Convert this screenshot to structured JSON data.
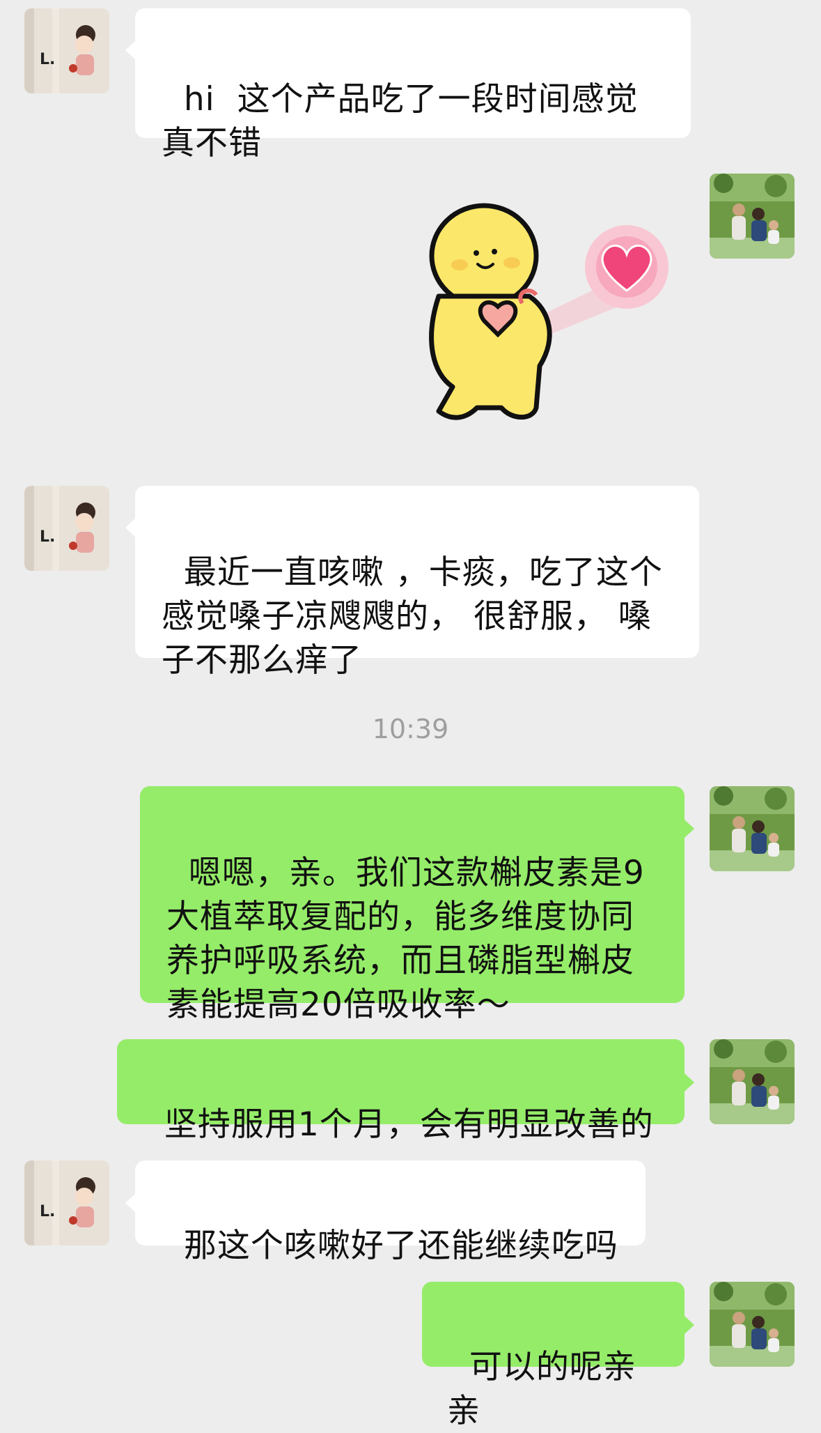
{
  "messages": [
    {
      "from": "contact",
      "text": "hi  这个产品吃了一段时间感觉真不错"
    },
    {
      "from": "me",
      "type": "sticker",
      "sticker": "yellow-blob-heart-gesture-sticker"
    },
    {
      "from": "contact",
      "text": "最近一直咳嗽 ，卡痰，吃了这个感觉嗓子凉飕飕的， 很舒服， 嗓子不那么痒了"
    },
    {
      "from": "me",
      "text": "嗯嗯，亲。我们这款槲皮素是9大植萃取复配的，能多维度协同养护呼吸系统，而且磷脂型槲皮素能提高20倍吸收率～"
    },
    {
      "from": "me",
      "text": "坚持服用1个月，会有明显改善的"
    },
    {
      "from": "contact",
      "text": "那这个咳嗽好了还能继续吃吗"
    },
    {
      "from": "me",
      "text": "可以的呢亲亲"
    }
  ],
  "timestamp": "10:39",
  "avatars": {
    "contact": {
      "icon": "cartoon-girl-avatar",
      "letter": "L"
    },
    "me": {
      "icon": "family-photo-avatar"
    }
  },
  "colors": {
    "background": "#ededed",
    "incoming_bubble": "#ffffff",
    "outgoing_bubble": "#95ec69",
    "timestamp_text": "#9e9e9e"
  }
}
